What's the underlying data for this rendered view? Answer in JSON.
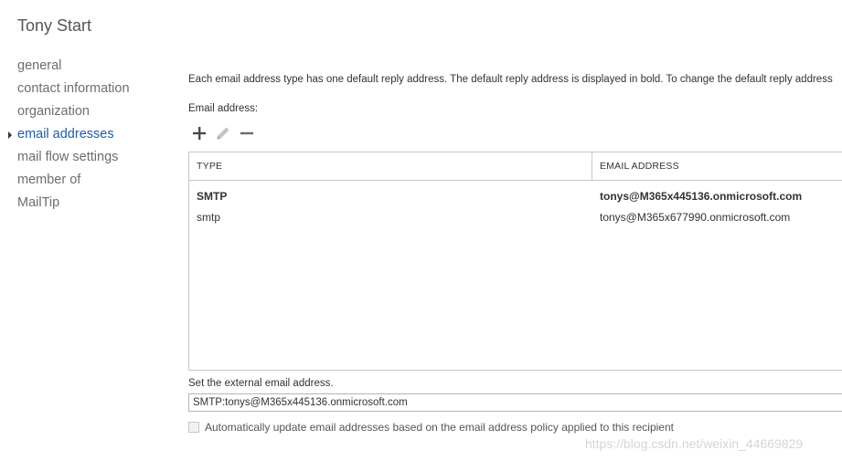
{
  "page": {
    "title": "Tony Start"
  },
  "nav": {
    "items": [
      {
        "label": "general"
      },
      {
        "label": "contact information"
      },
      {
        "label": "organization"
      },
      {
        "label": "email addresses",
        "selected": true
      },
      {
        "label": "mail flow settings"
      },
      {
        "label": "member of"
      },
      {
        "label": "MailTip"
      }
    ]
  },
  "main": {
    "description": "Each email address type has one default reply address. The default reply address is displayed in bold. To change the default reply address",
    "email_label": "Email address:",
    "toolbar": {
      "add_icon": "plus-icon",
      "edit_icon": "pencil-icon",
      "remove_icon": "minus-icon"
    },
    "grid": {
      "headers": {
        "type": "TYPE",
        "address": "EMAIL ADDRESS"
      },
      "rows": [
        {
          "type": "SMTP",
          "address": "tonys@M365x445136.onmicrosoft.com",
          "default": true
        },
        {
          "type": "smtp",
          "address": "tonys@M365x677990.onmicrosoft.com",
          "default": false
        }
      ]
    },
    "external": {
      "label": "Set the external email address.",
      "value": "SMTP:tonys@M365x445136.onmicrosoft.com"
    },
    "auto_update": {
      "label": "Automatically update email addresses based on the email address policy applied to this recipient",
      "checked": false
    }
  },
  "watermark": "https://blog.csdn.net/weixin_44669829",
  "colors": {
    "selected_nav": "#1e5ca8",
    "text": "#333333",
    "muted": "#6d6d6d",
    "border": "#c8c8c8"
  }
}
